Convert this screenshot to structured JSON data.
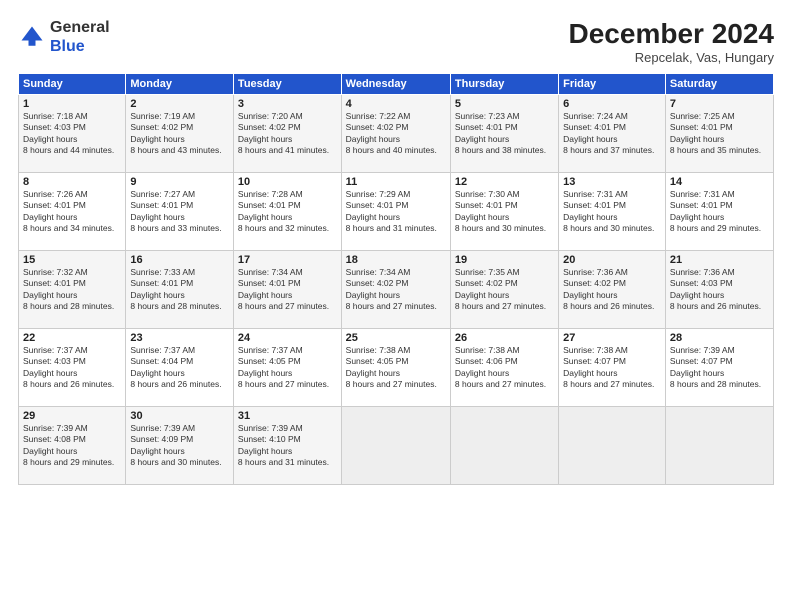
{
  "header": {
    "logo_general": "General",
    "logo_blue": "Blue",
    "month_year": "December 2024",
    "location": "Repcelak, Vas, Hungary"
  },
  "weekdays": [
    "Sunday",
    "Monday",
    "Tuesday",
    "Wednesday",
    "Thursday",
    "Friday",
    "Saturday"
  ],
  "weeks": [
    [
      {
        "day": "1",
        "sunrise": "7:18 AM",
        "sunset": "4:03 PM",
        "daylight": "8 hours and 44 minutes."
      },
      {
        "day": "2",
        "sunrise": "7:19 AM",
        "sunset": "4:02 PM",
        "daylight": "8 hours and 43 minutes."
      },
      {
        "day": "3",
        "sunrise": "7:20 AM",
        "sunset": "4:02 PM",
        "daylight": "8 hours and 41 minutes."
      },
      {
        "day": "4",
        "sunrise": "7:22 AM",
        "sunset": "4:02 PM",
        "daylight": "8 hours and 40 minutes."
      },
      {
        "day": "5",
        "sunrise": "7:23 AM",
        "sunset": "4:01 PM",
        "daylight": "8 hours and 38 minutes."
      },
      {
        "day": "6",
        "sunrise": "7:24 AM",
        "sunset": "4:01 PM",
        "daylight": "8 hours and 37 minutes."
      },
      {
        "day": "7",
        "sunrise": "7:25 AM",
        "sunset": "4:01 PM",
        "daylight": "8 hours and 35 minutes."
      }
    ],
    [
      {
        "day": "8",
        "sunrise": "7:26 AM",
        "sunset": "4:01 PM",
        "daylight": "8 hours and 34 minutes."
      },
      {
        "day": "9",
        "sunrise": "7:27 AM",
        "sunset": "4:01 PM",
        "daylight": "8 hours and 33 minutes."
      },
      {
        "day": "10",
        "sunrise": "7:28 AM",
        "sunset": "4:01 PM",
        "daylight": "8 hours and 32 minutes."
      },
      {
        "day": "11",
        "sunrise": "7:29 AM",
        "sunset": "4:01 PM",
        "daylight": "8 hours and 31 minutes."
      },
      {
        "day": "12",
        "sunrise": "7:30 AM",
        "sunset": "4:01 PM",
        "daylight": "8 hours and 30 minutes."
      },
      {
        "day": "13",
        "sunrise": "7:31 AM",
        "sunset": "4:01 PM",
        "daylight": "8 hours and 30 minutes."
      },
      {
        "day": "14",
        "sunrise": "7:31 AM",
        "sunset": "4:01 PM",
        "daylight": "8 hours and 29 minutes."
      }
    ],
    [
      {
        "day": "15",
        "sunrise": "7:32 AM",
        "sunset": "4:01 PM",
        "daylight": "8 hours and 28 minutes."
      },
      {
        "day": "16",
        "sunrise": "7:33 AM",
        "sunset": "4:01 PM",
        "daylight": "8 hours and 28 minutes."
      },
      {
        "day": "17",
        "sunrise": "7:34 AM",
        "sunset": "4:01 PM",
        "daylight": "8 hours and 27 minutes."
      },
      {
        "day": "18",
        "sunrise": "7:34 AM",
        "sunset": "4:02 PM",
        "daylight": "8 hours and 27 minutes."
      },
      {
        "day": "19",
        "sunrise": "7:35 AM",
        "sunset": "4:02 PM",
        "daylight": "8 hours and 27 minutes."
      },
      {
        "day": "20",
        "sunrise": "7:36 AM",
        "sunset": "4:02 PM",
        "daylight": "8 hours and 26 minutes."
      },
      {
        "day": "21",
        "sunrise": "7:36 AM",
        "sunset": "4:03 PM",
        "daylight": "8 hours and 26 minutes."
      }
    ],
    [
      {
        "day": "22",
        "sunrise": "7:37 AM",
        "sunset": "4:03 PM",
        "daylight": "8 hours and 26 minutes."
      },
      {
        "day": "23",
        "sunrise": "7:37 AM",
        "sunset": "4:04 PM",
        "daylight": "8 hours and 26 minutes."
      },
      {
        "day": "24",
        "sunrise": "7:37 AM",
        "sunset": "4:05 PM",
        "daylight": "8 hours and 27 minutes."
      },
      {
        "day": "25",
        "sunrise": "7:38 AM",
        "sunset": "4:05 PM",
        "daylight": "8 hours and 27 minutes."
      },
      {
        "day": "26",
        "sunrise": "7:38 AM",
        "sunset": "4:06 PM",
        "daylight": "8 hours and 27 minutes."
      },
      {
        "day": "27",
        "sunrise": "7:38 AM",
        "sunset": "4:07 PM",
        "daylight": "8 hours and 27 minutes."
      },
      {
        "day": "28",
        "sunrise": "7:39 AM",
        "sunset": "4:07 PM",
        "daylight": "8 hours and 28 minutes."
      }
    ],
    [
      {
        "day": "29",
        "sunrise": "7:39 AM",
        "sunset": "4:08 PM",
        "daylight": "8 hours and 29 minutes."
      },
      {
        "day": "30",
        "sunrise": "7:39 AM",
        "sunset": "4:09 PM",
        "daylight": "8 hours and 30 minutes."
      },
      {
        "day": "31",
        "sunrise": "7:39 AM",
        "sunset": "4:10 PM",
        "daylight": "8 hours and 31 minutes."
      },
      null,
      null,
      null,
      null
    ]
  ]
}
